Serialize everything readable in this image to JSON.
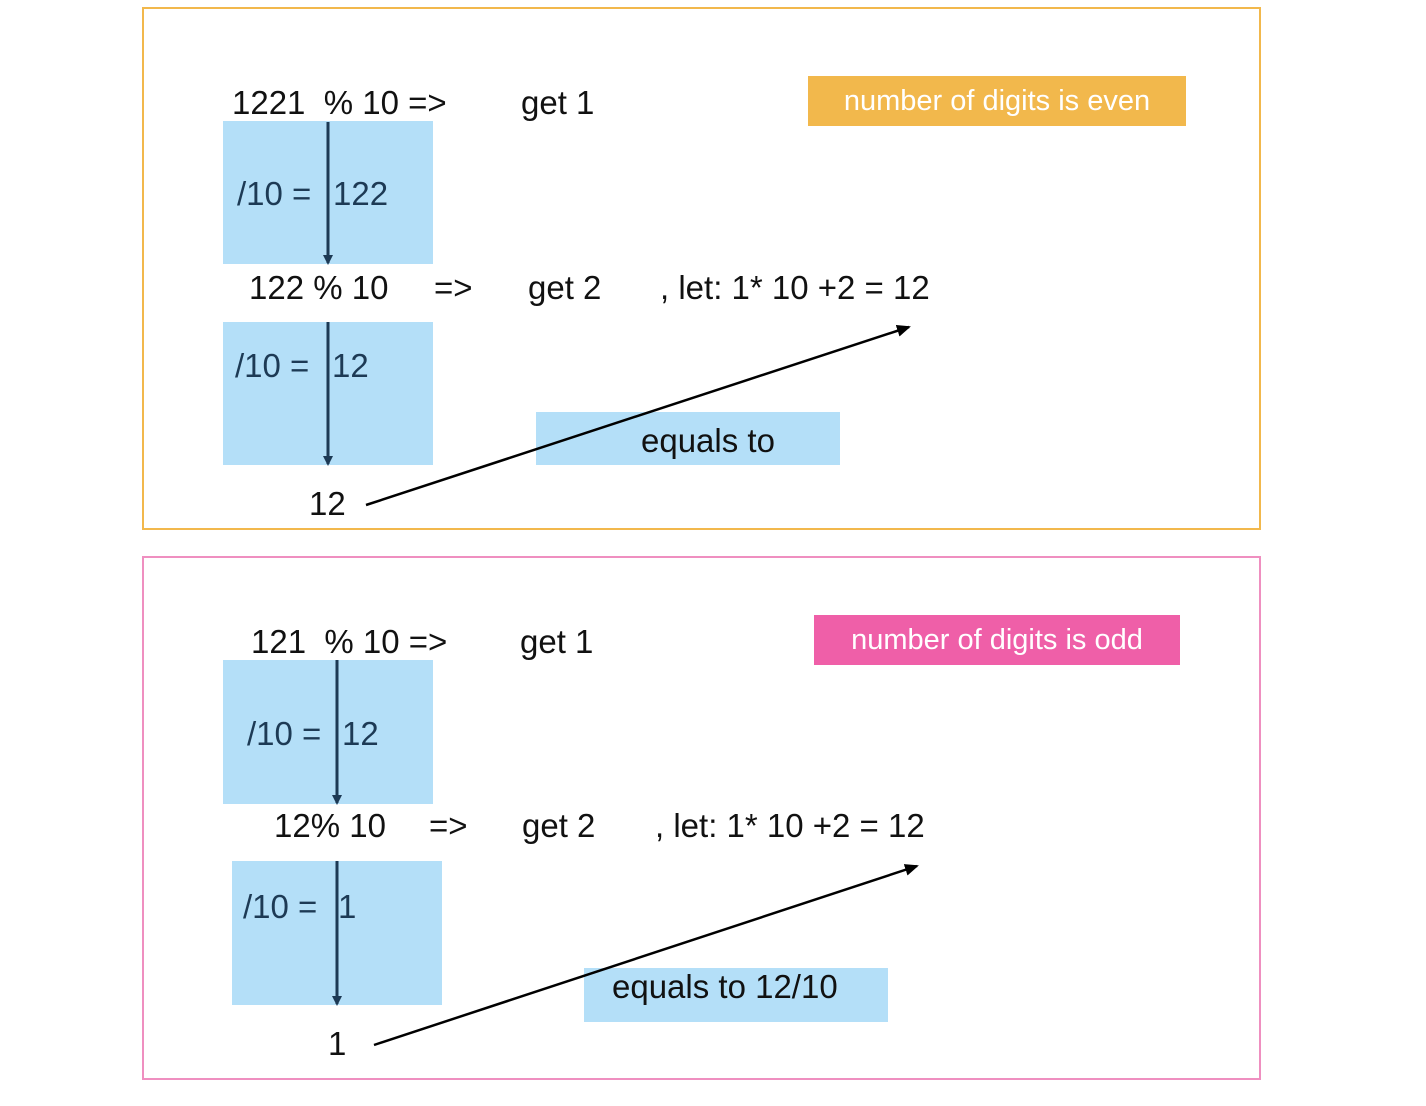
{
  "colors": {
    "even_accent": "#f2b84c",
    "odd_accent": "#ef5fa8",
    "highlight": "#b4dff8",
    "vertical_arrow": "#1d3a55",
    "diagonal_arrow": "#000000"
  },
  "even": {
    "badge": "number of digits is even",
    "row1": {
      "expr": "1221  % 10 =>",
      "result": "get 1"
    },
    "div1": {
      "op": "/10 =",
      "value": "122"
    },
    "row2": {
      "expr": "122 % 10",
      "arrow": "=>",
      "result": "get 2",
      "note": ", let: 1* 10 +2 = 12"
    },
    "div2": {
      "op": "/10 =",
      "value": "12"
    },
    "final": "12",
    "equals_label": "equals to"
  },
  "odd": {
    "badge": "number of digits is odd",
    "row1": {
      "expr": "121  % 10 =>",
      "result": "get 1"
    },
    "div1": {
      "op": "/10 =",
      "value": "12"
    },
    "row2": {
      "expr": "12% 10",
      "arrow": "=>",
      "result": "get 2",
      "note": ", let: 1* 10 +2 = 12"
    },
    "div2": {
      "op": "/10 =",
      "value": "1"
    },
    "final": "1",
    "equals_label": "equals to 12/10"
  }
}
